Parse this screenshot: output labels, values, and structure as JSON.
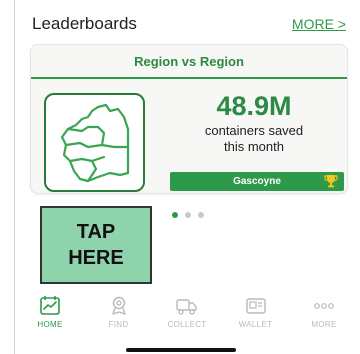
{
  "header": {
    "title": "Leaderboards",
    "more_link": "MORE >"
  },
  "card": {
    "title": "Region vs Region",
    "stat_value": "48.9M",
    "stat_label_line1": "containers saved",
    "stat_label_line2": "this month",
    "region": "Gascoyne"
  },
  "promo": {
    "line1": "TAP",
    "line2": "HERE"
  },
  "carousel": {
    "page_count": 3,
    "active_index": 0
  },
  "tabs": [
    {
      "label": "HOME",
      "icon": "home-chart-icon",
      "active": true
    },
    {
      "label": "FIND",
      "icon": "find-pin-icon",
      "active": false
    },
    {
      "label": "COLLECT",
      "icon": "collect-truck-icon",
      "active": false
    },
    {
      "label": "WALLET",
      "icon": "wallet-icon",
      "active": false
    },
    {
      "label": "MORE",
      "icon": "more-dots-icon",
      "active": false
    }
  ],
  "colors": {
    "brand_green": "#2d9a4a",
    "promo_bg": "#8fd3ad",
    "inactive": "#b9b9b9"
  }
}
